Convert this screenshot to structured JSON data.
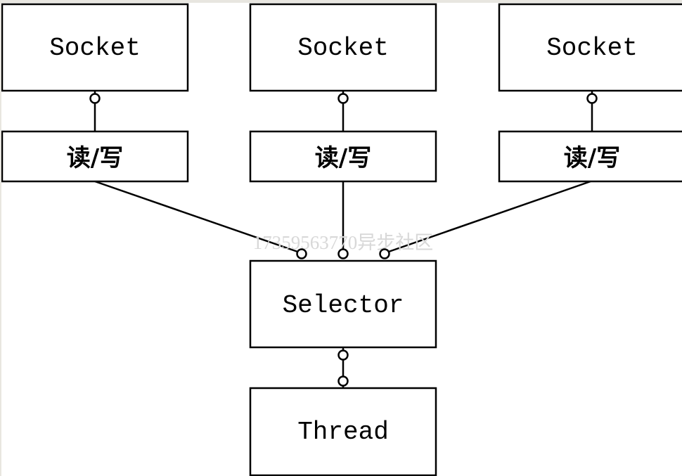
{
  "diagram": {
    "sockets": [
      {
        "label": "Socket",
        "io_label": "读/写"
      },
      {
        "label": "Socket",
        "io_label": "读/写"
      },
      {
        "label": "Socket",
        "io_label": "读/写"
      }
    ],
    "selector": {
      "label": "Selector"
    },
    "thread": {
      "label": "Thread"
    },
    "watermark": "17359563770异步社区"
  }
}
